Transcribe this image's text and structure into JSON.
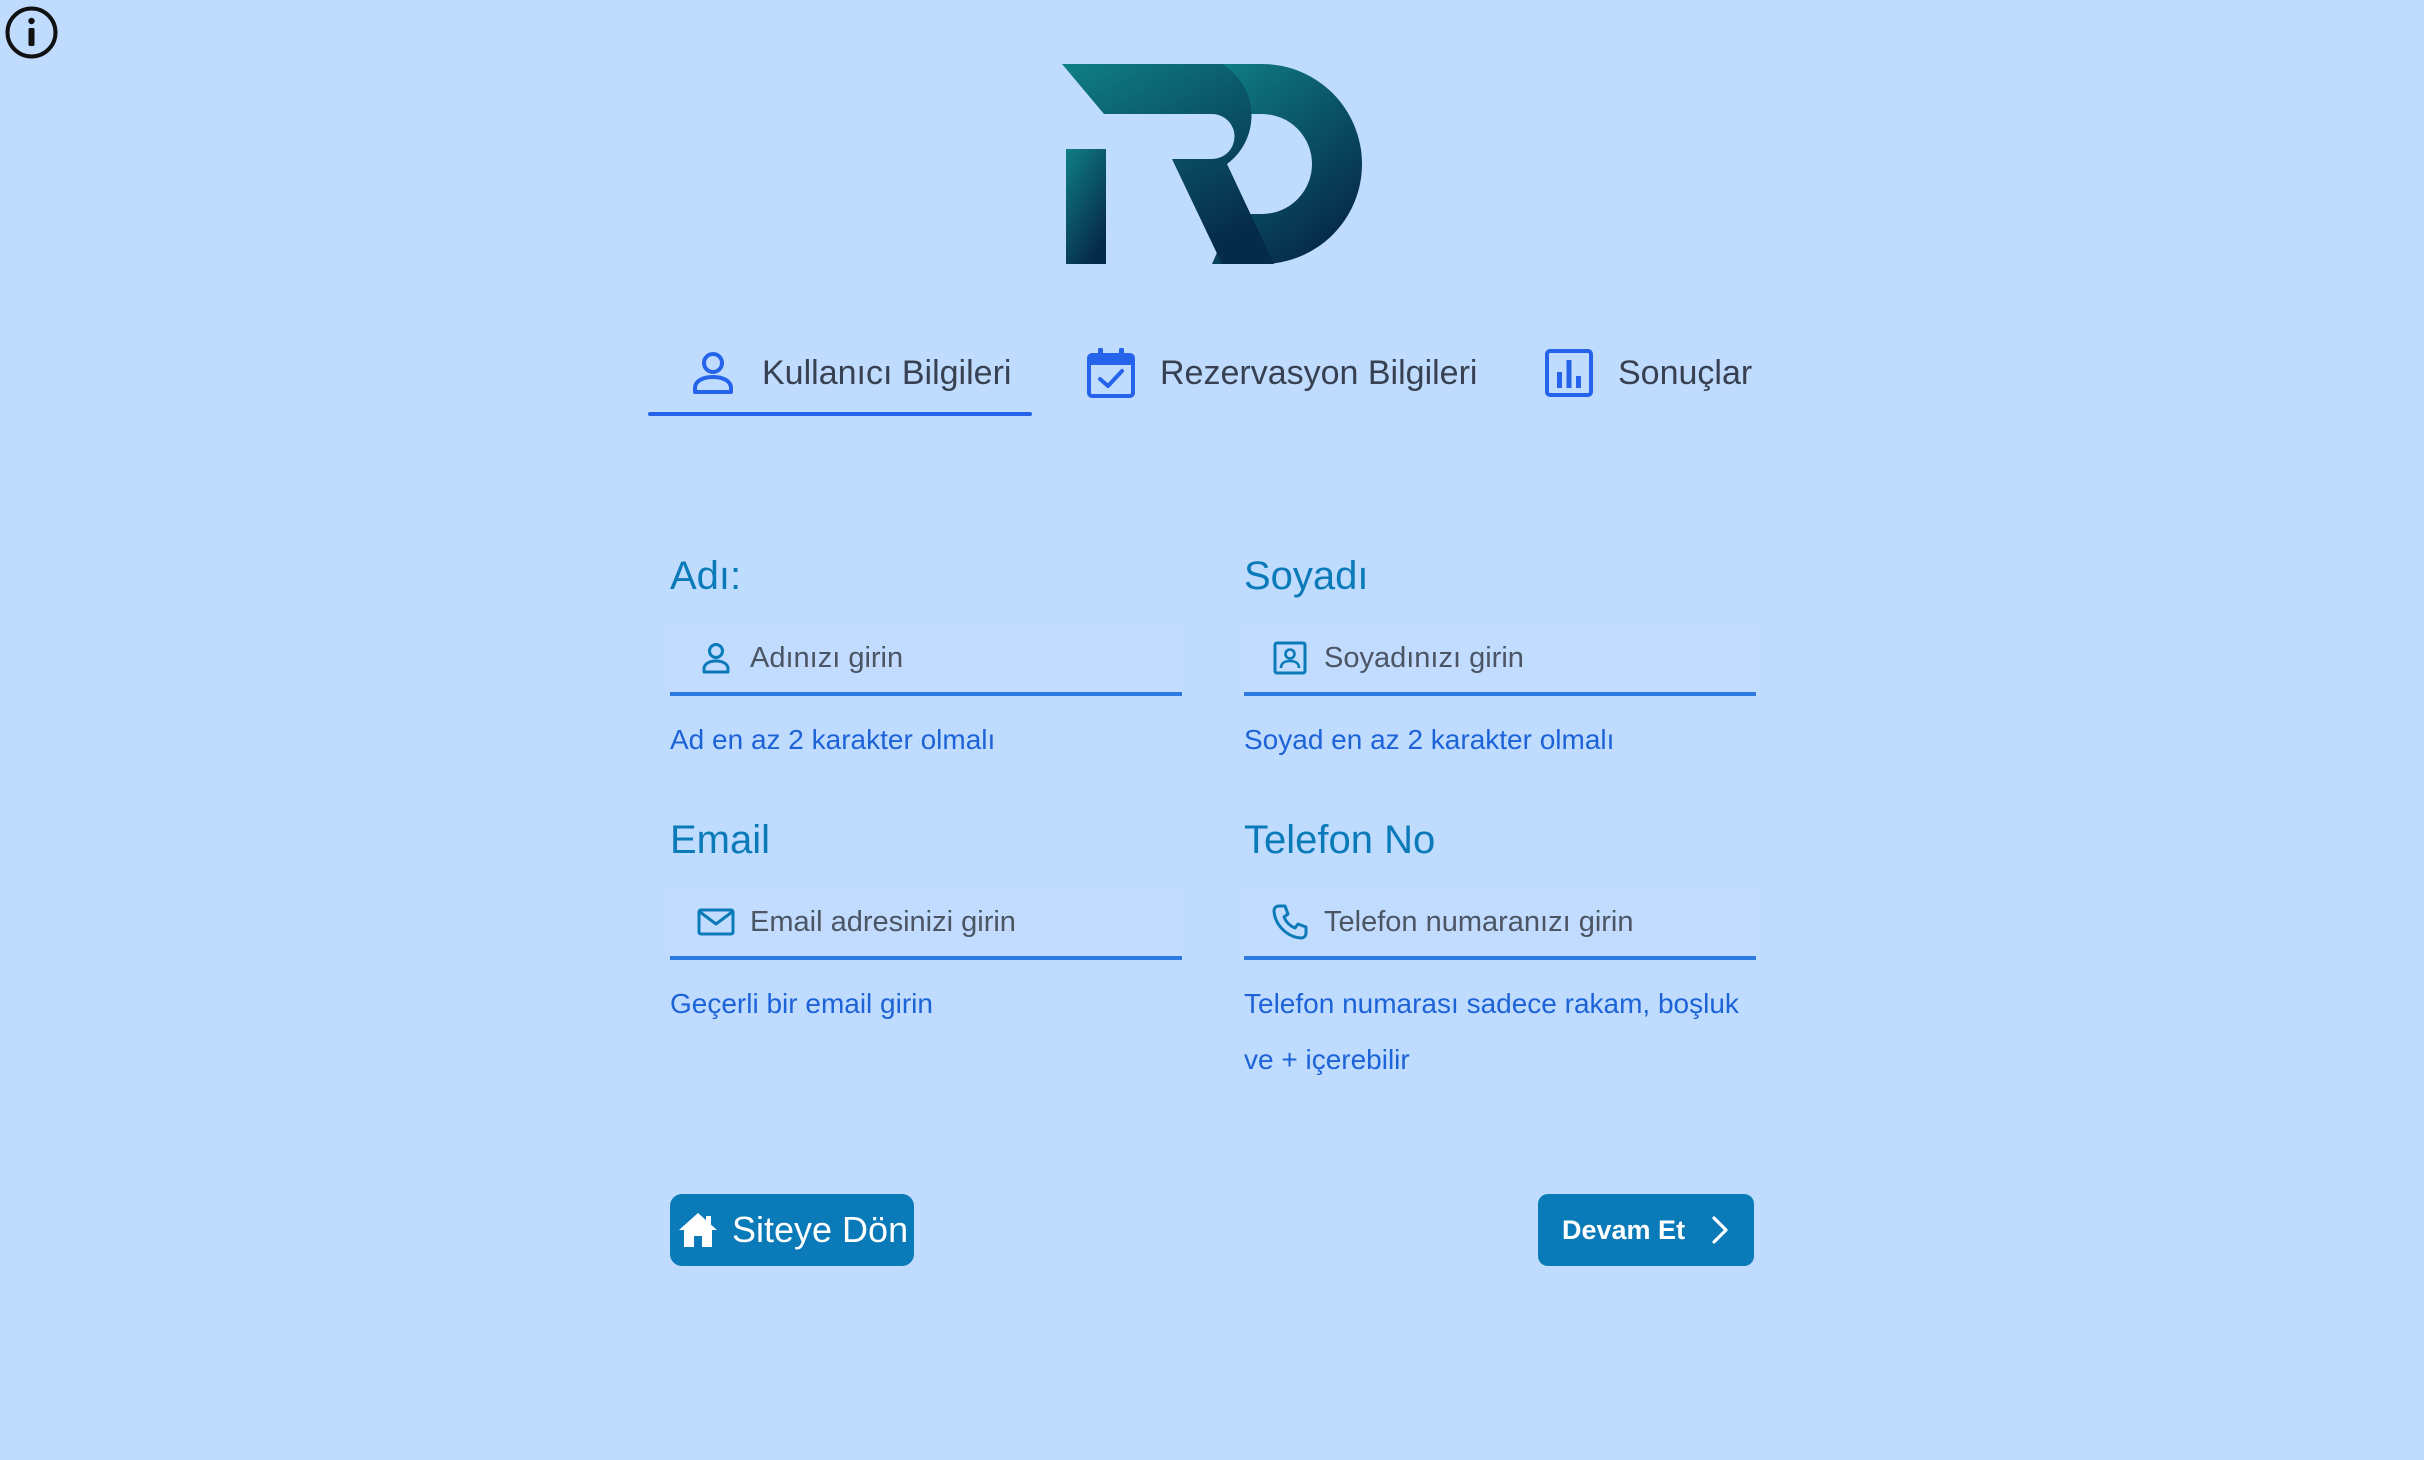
{
  "header": {
    "info_icon": "info-icon",
    "logo_text": "RD"
  },
  "tabs": [
    {
      "label": "Kullanıcı Bilgileri",
      "icon": "person-icon",
      "active": true
    },
    {
      "label": "Rezervasyon Bilgileri",
      "icon": "calendar-check-icon",
      "active": false
    },
    {
      "label": "Sonuçlar",
      "icon": "bar-chart-icon",
      "active": false
    }
  ],
  "form": {
    "first_name": {
      "label": "Adı:",
      "placeholder": "Adınızı girin",
      "value": "",
      "icon": "person-icon",
      "hint": "Ad en az 2 karakter olmalı"
    },
    "last_name": {
      "label": "Soyadı",
      "placeholder": "Soyadınızı girin",
      "value": "",
      "icon": "contact-card-icon",
      "hint": "Soyad en az 2 karakter olmalı"
    },
    "email": {
      "label": "Email",
      "placeholder": "Email adresinizi girin",
      "value": "",
      "icon": "envelope-icon",
      "hint": "Geçerli bir email girin"
    },
    "phone": {
      "label": "Telefon No",
      "placeholder": "Telefon numaranızı girin",
      "value": "",
      "icon": "phone-icon",
      "hint": "Telefon numarası sadece rakam, boşluk ve + içerebilir"
    }
  },
  "actions": {
    "back_label": "Siteye Dön",
    "back_icon": "home-icon",
    "next_label": "Devam Et",
    "next_icon": "chevron-right-icon"
  },
  "colors": {
    "background": "#bfdbfe",
    "accent": "#2563eb",
    "button": "#0a7ab8",
    "label": "#0a7ab8",
    "hint": "#1d63d8"
  }
}
